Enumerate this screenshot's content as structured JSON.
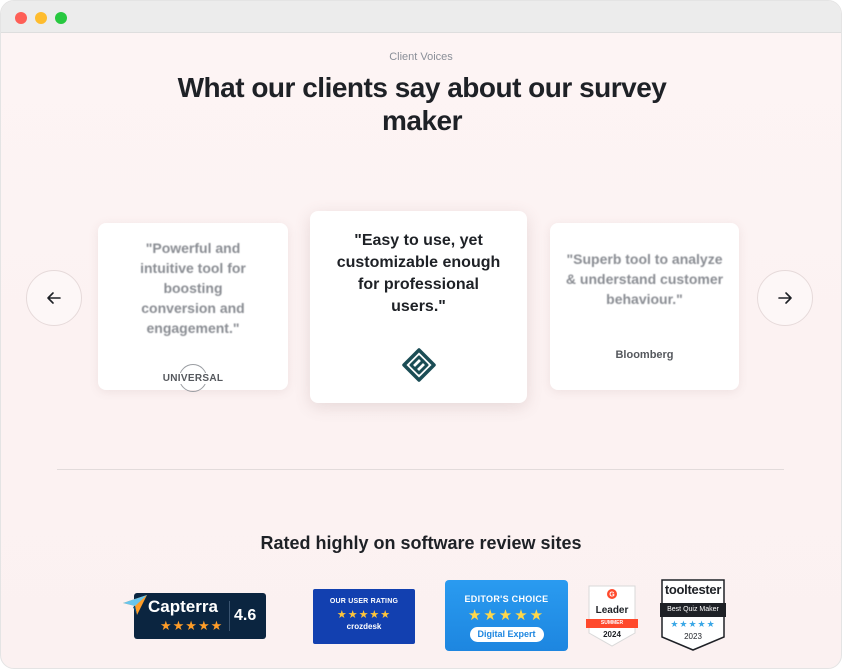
{
  "section": {
    "eyebrow": "Client Voices",
    "headline": "What our clients say about our survey maker"
  },
  "testimonials": [
    {
      "quote": "\"Powerful and intuitive tool for boosting conversion and engagement.\"",
      "logo": "UNIVERSAL"
    },
    {
      "quote": "\"Easy to use, yet customizable enough for professional users.\"",
      "logo": "diamond-logo-icon"
    },
    {
      "quote": "\"Superb tool to analyze & understand customer behaviour.\"",
      "logo": "Bloomberg"
    }
  ],
  "carousel": {
    "prev_icon": "arrow-left-icon",
    "next_icon": "arrow-right-icon"
  },
  "ratings": {
    "heading": "Rated highly on software review sites",
    "capterra": {
      "name": "Capterra",
      "score": "4.6",
      "stars": "★★★★★"
    },
    "crozdesk": {
      "title": "OUR USER RATING",
      "stars": "★★★★★",
      "brand": "crozdesk"
    },
    "editors_choice": {
      "title": "EDITOR'S CHOICE",
      "stars": "★★★★★",
      "pill": "Digital Expert"
    },
    "g2": {
      "label": "Leader",
      "season": "SUMMER",
      "year": "2024"
    },
    "tooltester": {
      "name": "tooltester",
      "award": "Best Quiz Maker",
      "stars": "★★★★★",
      "year": "2023"
    }
  },
  "colors": {
    "capterra_bg": "#0b2540",
    "capterra_star": "#ff9d28",
    "crozdesk_bg": "#1240b0",
    "editors_bg": "#1d86e0",
    "g2_red": "#ff492c"
  }
}
